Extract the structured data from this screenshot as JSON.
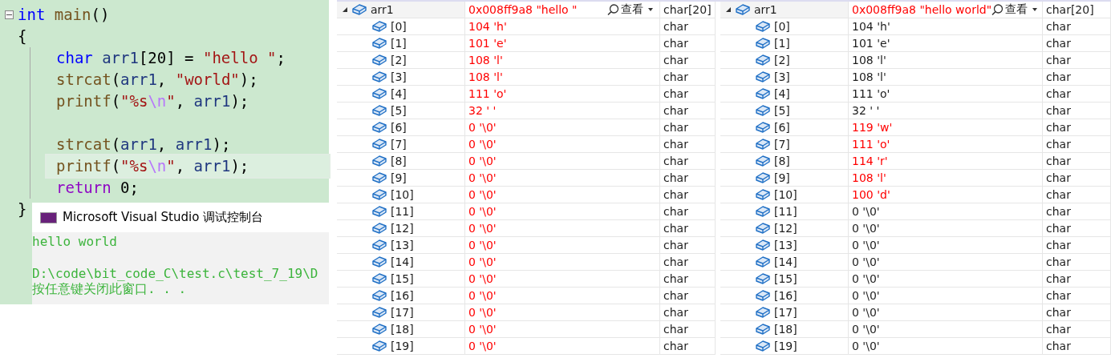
{
  "editor": {
    "function": {
      "header": [
        {
          "kind": "keyword",
          "text": "int"
        },
        {
          "kind": "function",
          "text": "main"
        },
        {
          "kind": "punct",
          "text": "()"
        }
      ],
      "collapse_toggle": {
        "expanded": true
      },
      "open": "{",
      "body": [
        {
          "kind": "code",
          "current": false,
          "tokens": [
            {
              "kind": "keyword",
              "text": "char"
            },
            {
              "kind": "variable",
              "text": "arr1"
            },
            {
              "kind": "punct",
              "text": "[20] ="
            },
            {
              "kind": "string",
              "text": "\"hello \""
            },
            {
              "kind": "punct",
              "text": ";"
            }
          ]
        },
        {
          "kind": "code",
          "current": false,
          "tokens": [
            {
              "kind": "function",
              "text": "strcat"
            },
            {
              "kind": "punct",
              "text": "("
            },
            {
              "kind": "variable",
              "text": "arr1"
            },
            {
              "kind": "punct",
              "text": ","
            },
            {
              "kind": "string",
              "text": "\"world\""
            },
            {
              "kind": "punct",
              "text": ");"
            }
          ]
        },
        {
          "kind": "code",
          "current": false,
          "tokens": [
            {
              "kind": "function",
              "text": "printf"
            },
            {
              "kind": "punct",
              "text": "("
            },
            {
              "kind": "string",
              "text": "\"%s"
            },
            {
              "kind": "escape",
              "text": "\\n"
            },
            {
              "kind": "string",
              "text": "\""
            },
            {
              "kind": "punct",
              "text": ","
            },
            {
              "kind": "variable",
              "text": "arr1"
            },
            {
              "kind": "punct",
              "text": ");"
            }
          ]
        },
        {
          "kind": "blank",
          "current": false
        },
        {
          "kind": "code",
          "current": false,
          "tokens": [
            {
              "kind": "function",
              "text": "strcat"
            },
            {
              "kind": "punct",
              "text": "("
            },
            {
              "kind": "variable",
              "text": "arr1"
            },
            {
              "kind": "punct",
              "text": ","
            },
            {
              "kind": "variable",
              "text": "arr1"
            },
            {
              "kind": "punct",
              "text": ");"
            }
          ]
        },
        {
          "kind": "code",
          "current": true,
          "tokens": [
            {
              "kind": "function",
              "text": "printf"
            },
            {
              "kind": "punct",
              "text": "("
            },
            {
              "kind": "string",
              "text": "\"%s"
            },
            {
              "kind": "escape",
              "text": "\\n"
            },
            {
              "kind": "string",
              "text": "\""
            },
            {
              "kind": "punct",
              "text": ","
            },
            {
              "kind": "variable",
              "text": "arr1"
            },
            {
              "kind": "punct",
              "text": ");"
            }
          ]
        },
        {
          "kind": "code",
          "current": false,
          "tokens": [
            {
              "kind": "control",
              "text": "return"
            },
            {
              "kind": "number",
              "text": "0;"
            }
          ]
        }
      ],
      "close": "}"
    }
  },
  "console": {
    "title": "Microsoft Visual Studio 调试控制台",
    "lines": [
      {
        "kind": "output",
        "text": "hello world"
      },
      {
        "kind": "blank"
      },
      {
        "kind": "output",
        "text": "D:\\code\\bit_code_C\\test.c\\test_7_19\\D"
      },
      {
        "kind": "output",
        "text": "按任意键关闭此窗口. . ."
      }
    ]
  },
  "watch_panels": [
    {
      "root": {
        "name": "arr1",
        "value": "0x008ff9a8 \"hello \"",
        "changed": true,
        "expanded": true,
        "visualizer": "查看",
        "type": "char[20]"
      },
      "children": [
        {
          "name": "[0]",
          "value": "104 'h'",
          "changed": true,
          "type": "char"
        },
        {
          "name": "[1]",
          "value": "101 'e'",
          "changed": true,
          "type": "char"
        },
        {
          "name": "[2]",
          "value": "108 'l'",
          "changed": true,
          "type": "char"
        },
        {
          "name": "[3]",
          "value": "108 'l'",
          "changed": true,
          "type": "char"
        },
        {
          "name": "[4]",
          "value": "111 'o'",
          "changed": true,
          "type": "char"
        },
        {
          "name": "[5]",
          "value": "32 ' '",
          "changed": true,
          "type": "char"
        },
        {
          "name": "[6]",
          "value": "0 '\\0'",
          "changed": true,
          "type": "char"
        },
        {
          "name": "[7]",
          "value": "0 '\\0'",
          "changed": true,
          "type": "char"
        },
        {
          "name": "[8]",
          "value": "0 '\\0'",
          "changed": true,
          "type": "char"
        },
        {
          "name": "[9]",
          "value": "0 '\\0'",
          "changed": true,
          "type": "char"
        },
        {
          "name": "[10]",
          "value": "0 '\\0'",
          "changed": true,
          "type": "char"
        },
        {
          "name": "[11]",
          "value": "0 '\\0'",
          "changed": true,
          "type": "char"
        },
        {
          "name": "[12]",
          "value": "0 '\\0'",
          "changed": true,
          "type": "char"
        },
        {
          "name": "[13]",
          "value": "0 '\\0'",
          "changed": true,
          "type": "char"
        },
        {
          "name": "[14]",
          "value": "0 '\\0'",
          "changed": true,
          "type": "char"
        },
        {
          "name": "[15]",
          "value": "0 '\\0'",
          "changed": true,
          "type": "char"
        },
        {
          "name": "[16]",
          "value": "0 '\\0'",
          "changed": true,
          "type": "char"
        },
        {
          "name": "[17]",
          "value": "0 '\\0'",
          "changed": true,
          "type": "char"
        },
        {
          "name": "[18]",
          "value": "0 '\\0'",
          "changed": true,
          "type": "char"
        },
        {
          "name": "[19]",
          "value": "0 '\\0'",
          "changed": true,
          "type": "char"
        }
      ]
    },
    {
      "root": {
        "name": "arr1",
        "value": "0x008ff9a8 \"hello world\"",
        "changed": true,
        "expanded": true,
        "visualizer": "查看",
        "type": "char[20]"
      },
      "children": [
        {
          "name": "[0]",
          "value": "104 'h'",
          "changed": false,
          "type": "char"
        },
        {
          "name": "[1]",
          "value": "101 'e'",
          "changed": false,
          "type": "char"
        },
        {
          "name": "[2]",
          "value": "108 'l'",
          "changed": false,
          "type": "char"
        },
        {
          "name": "[3]",
          "value": "108 'l'",
          "changed": false,
          "type": "char"
        },
        {
          "name": "[4]",
          "value": "111 'o'",
          "changed": false,
          "type": "char"
        },
        {
          "name": "[5]",
          "value": "32 ' '",
          "changed": false,
          "type": "char"
        },
        {
          "name": "[6]",
          "value": "119 'w'",
          "changed": true,
          "type": "char"
        },
        {
          "name": "[7]",
          "value": "111 'o'",
          "changed": true,
          "type": "char"
        },
        {
          "name": "[8]",
          "value": "114 'r'",
          "changed": true,
          "type": "char"
        },
        {
          "name": "[9]",
          "value": "108 'l'",
          "changed": true,
          "type": "char"
        },
        {
          "name": "[10]",
          "value": "100 'd'",
          "changed": true,
          "type": "char"
        },
        {
          "name": "[11]",
          "value": "0 '\\0'",
          "changed": false,
          "type": "char"
        },
        {
          "name": "[12]",
          "value": "0 '\\0'",
          "changed": false,
          "type": "char"
        },
        {
          "name": "[13]",
          "value": "0 '\\0'",
          "changed": false,
          "type": "char"
        },
        {
          "name": "[14]",
          "value": "0 '\\0'",
          "changed": false,
          "type": "char"
        },
        {
          "name": "[15]",
          "value": "0 '\\0'",
          "changed": false,
          "type": "char"
        },
        {
          "name": "[16]",
          "value": "0 '\\0'",
          "changed": false,
          "type": "char"
        },
        {
          "name": "[17]",
          "value": "0 '\\0'",
          "changed": false,
          "type": "char"
        },
        {
          "name": "[18]",
          "value": "0 '\\0'",
          "changed": false,
          "type": "char"
        },
        {
          "name": "[19]",
          "value": "0 '\\0'",
          "changed": false,
          "type": "char"
        }
      ]
    }
  ]
}
